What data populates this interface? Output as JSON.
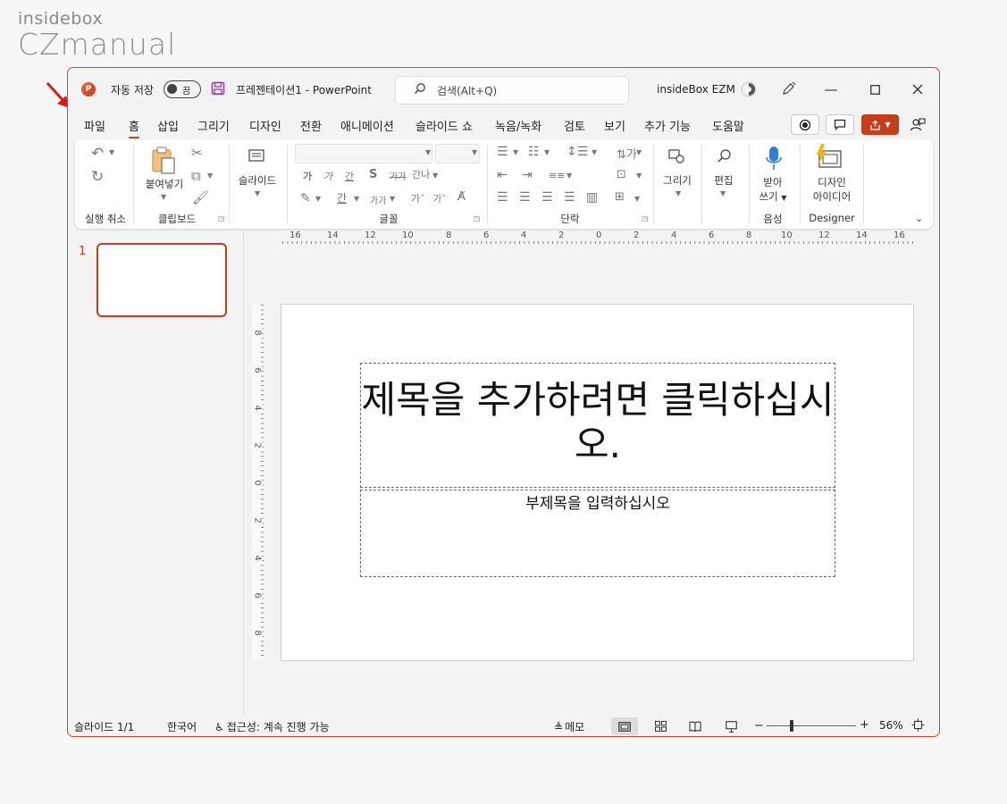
{
  "watermark": {
    "line1": "insidebox",
    "line2": "CZmanual"
  },
  "titlebar": {
    "autosave_label": "자동 저장",
    "autosave_state": "끔",
    "doc_name": "프레젠테이션1",
    "separator": "-",
    "app_name": "PowerPoint",
    "search_placeholder": "검색(Alt+Q)",
    "user_name": "insideBox EZM"
  },
  "tabs": [
    "파일",
    "홈",
    "삽입",
    "그리기",
    "디자인",
    "전환",
    "애니메이션",
    "슬라이드 쇼",
    "녹음/녹화",
    "검토",
    "보기",
    "추가 기능",
    "도움말"
  ],
  "active_tab": "홈",
  "ribbon": {
    "groups": {
      "undo": "실행 취소",
      "clipboard": "클립보드",
      "font": "글꼴",
      "paragraph": "단락",
      "voice": "음성",
      "designer": "Designer"
    },
    "buttons": {
      "paste": "붙여넣기",
      "slides": "슬라이드",
      "draw": "그리기",
      "edit": "편집",
      "dictate_line1": "받아",
      "dictate_line2": "쓰기",
      "designer_line1": "디자인",
      "designer_line2": "아이디어"
    },
    "font_glyph": "가",
    "font_small_glyph": "가가",
    "font_pair_glyph": "간나",
    "spacing_glyph": "간",
    "strike_glyph": "가",
    "shadow_glyph": "S"
  },
  "slides_panel": {
    "slide_number": "1"
  },
  "slide": {
    "title_placeholder": "제목을 추가하려면 클릭하십시오.",
    "subtitle_placeholder": "부제목을 입력하십시오"
  },
  "status": {
    "slide_count": "슬라이드 1/1",
    "language": "한국어",
    "accessibility": "접근성: 계속 진행 가능",
    "notes": "메모",
    "zoom_minus": "−",
    "zoom_plus": "+",
    "zoom": "56%"
  },
  "colors": {
    "accent": "#c43e1c",
    "window_bg": "#f3f3f3",
    "ribbon_bg": "#ffffff"
  }
}
